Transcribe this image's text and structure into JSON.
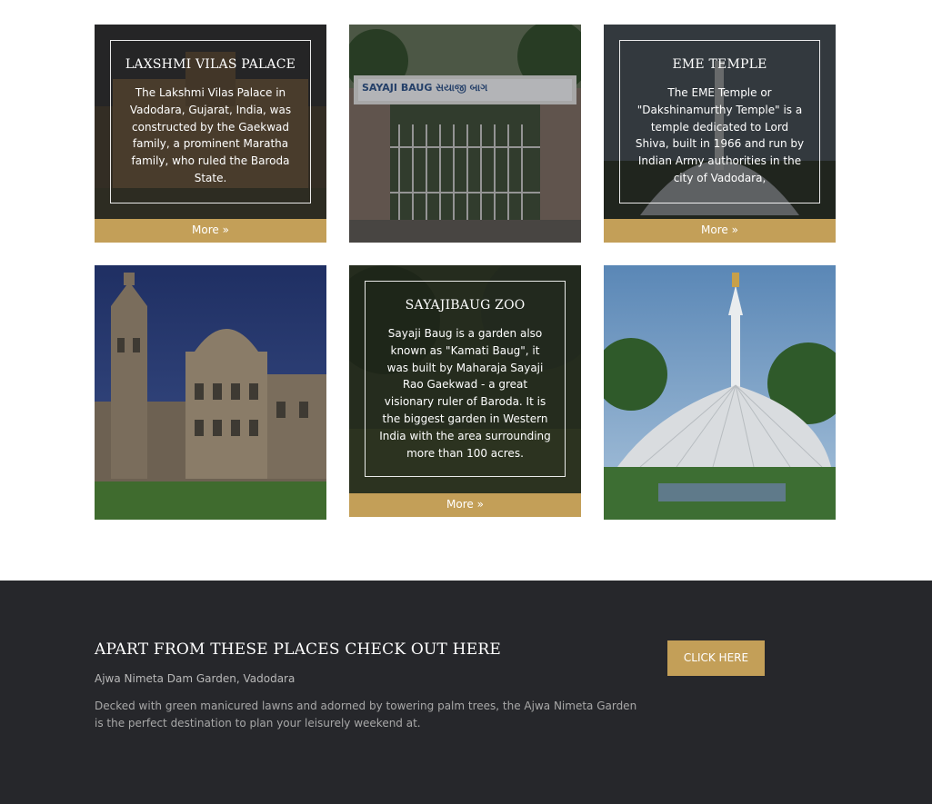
{
  "cards": [
    {
      "title": "LAXSHMI VILAS PALACE",
      "text": "The Lakshmi Vilas Palace in Vadodara, Gujarat, India, was constructed by the Gaekwad family, a prominent Maratha family, who ruled the Baroda State.",
      "more": "More »"
    },
    {
      "sign": "SAYAJI BAUG સયાજી બાગ"
    },
    {
      "title": "EME TEMPLE",
      "text": "The EME Temple or \"Dakshinamurthy Temple\" is a temple dedicated to Lord Shiva, built in 1966 and run by Indian Army authorities in the city of Vadodara,",
      "more": "More »"
    },
    {},
    {
      "title": "SAYAJIBAUG ZOO",
      "text": "Sayaji Baug is a garden also known as \"Kamati Baug\", it was built by Maharaja Sayaji Rao Gaekwad - a great visionary ruler of Baroda. It is the biggest garden in Western India with the area surrounding more than 100 acres.",
      "more": "More »"
    },
    {}
  ],
  "footer": {
    "heading": "APART FROM THESE PLACES CHECK OUT HERE",
    "subheading": "Ajwa Nimeta Dam Garden, Vadodara",
    "description": "Decked with green manicured lawns and adorned by towering palm trees, the Ajwa Nimeta Garden is the perfect destination to plan your leisurely weekend at.",
    "button": "CLICK HERE"
  },
  "colors": {
    "accent": "#c39f58",
    "footer_bg": "#26272b"
  }
}
